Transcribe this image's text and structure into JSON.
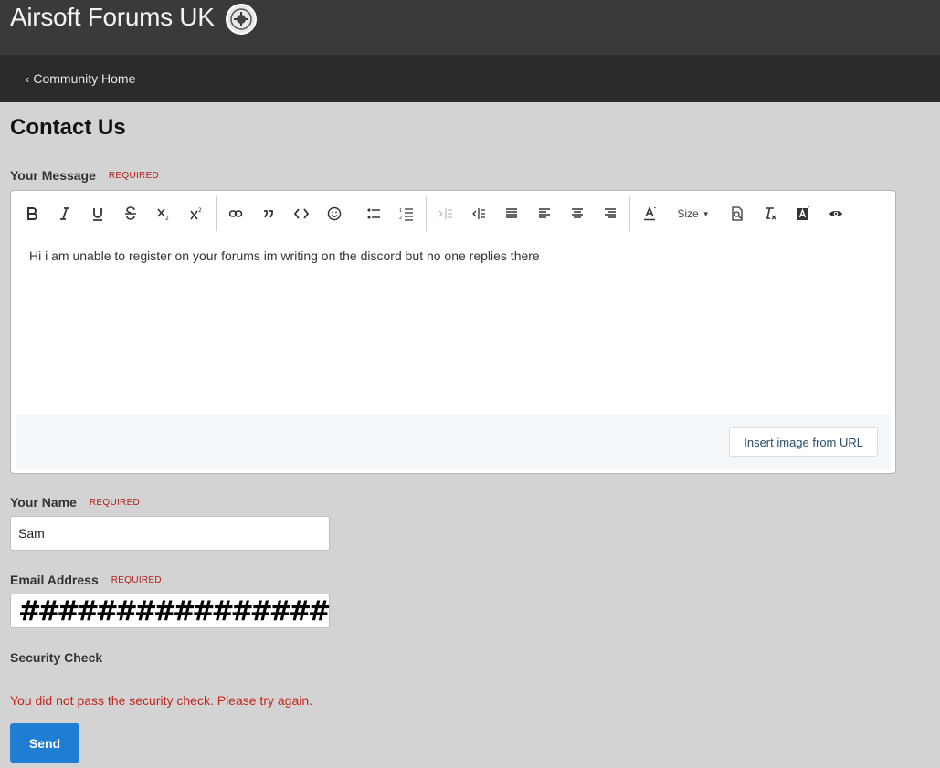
{
  "header": {
    "site_title": "Airsoft Forums UK"
  },
  "nav": {
    "community_home": "Community Home"
  },
  "page": {
    "title": "Contact Us"
  },
  "message": {
    "label": "Your Message",
    "required": "REQUIRED",
    "toolbar": {
      "size_label": "Size",
      "buttons": [
        "bold-icon",
        "italic-icon",
        "underline-icon",
        "strikethrough-icon",
        "subscript-icon",
        "superscript-icon",
        "link-icon",
        "quote-icon",
        "code-icon",
        "emoji-icon",
        "bulleted-list-icon",
        "numbered-list-icon",
        "outdent-icon",
        "indent-icon",
        "justify-icon",
        "align-left-icon",
        "align-center-icon",
        "align-right-icon",
        "text-color-icon",
        "font-size",
        "find-icon",
        "remove-format-icon",
        "background-color-icon",
        "preview-icon"
      ]
    },
    "body": "Hi i am unable to register on your forums im writing on the discord but no one replies there",
    "insert_image": "Insert image from URL"
  },
  "name": {
    "label": "Your Name",
    "required": "REQUIRED",
    "value": "Sam"
  },
  "email": {
    "label": "Email Address",
    "required": "REQUIRED",
    "value": "################"
  },
  "security": {
    "label": "Security Check",
    "error": "You did not pass the security check. Please try again."
  },
  "send": {
    "label": "Send"
  },
  "colors": {
    "header_bg": "#3a3a3a",
    "nav_bg": "#2b2b2b",
    "page_bg": "#d3d3d3",
    "primary": "#1f7dd3",
    "error": "#c0281f"
  }
}
